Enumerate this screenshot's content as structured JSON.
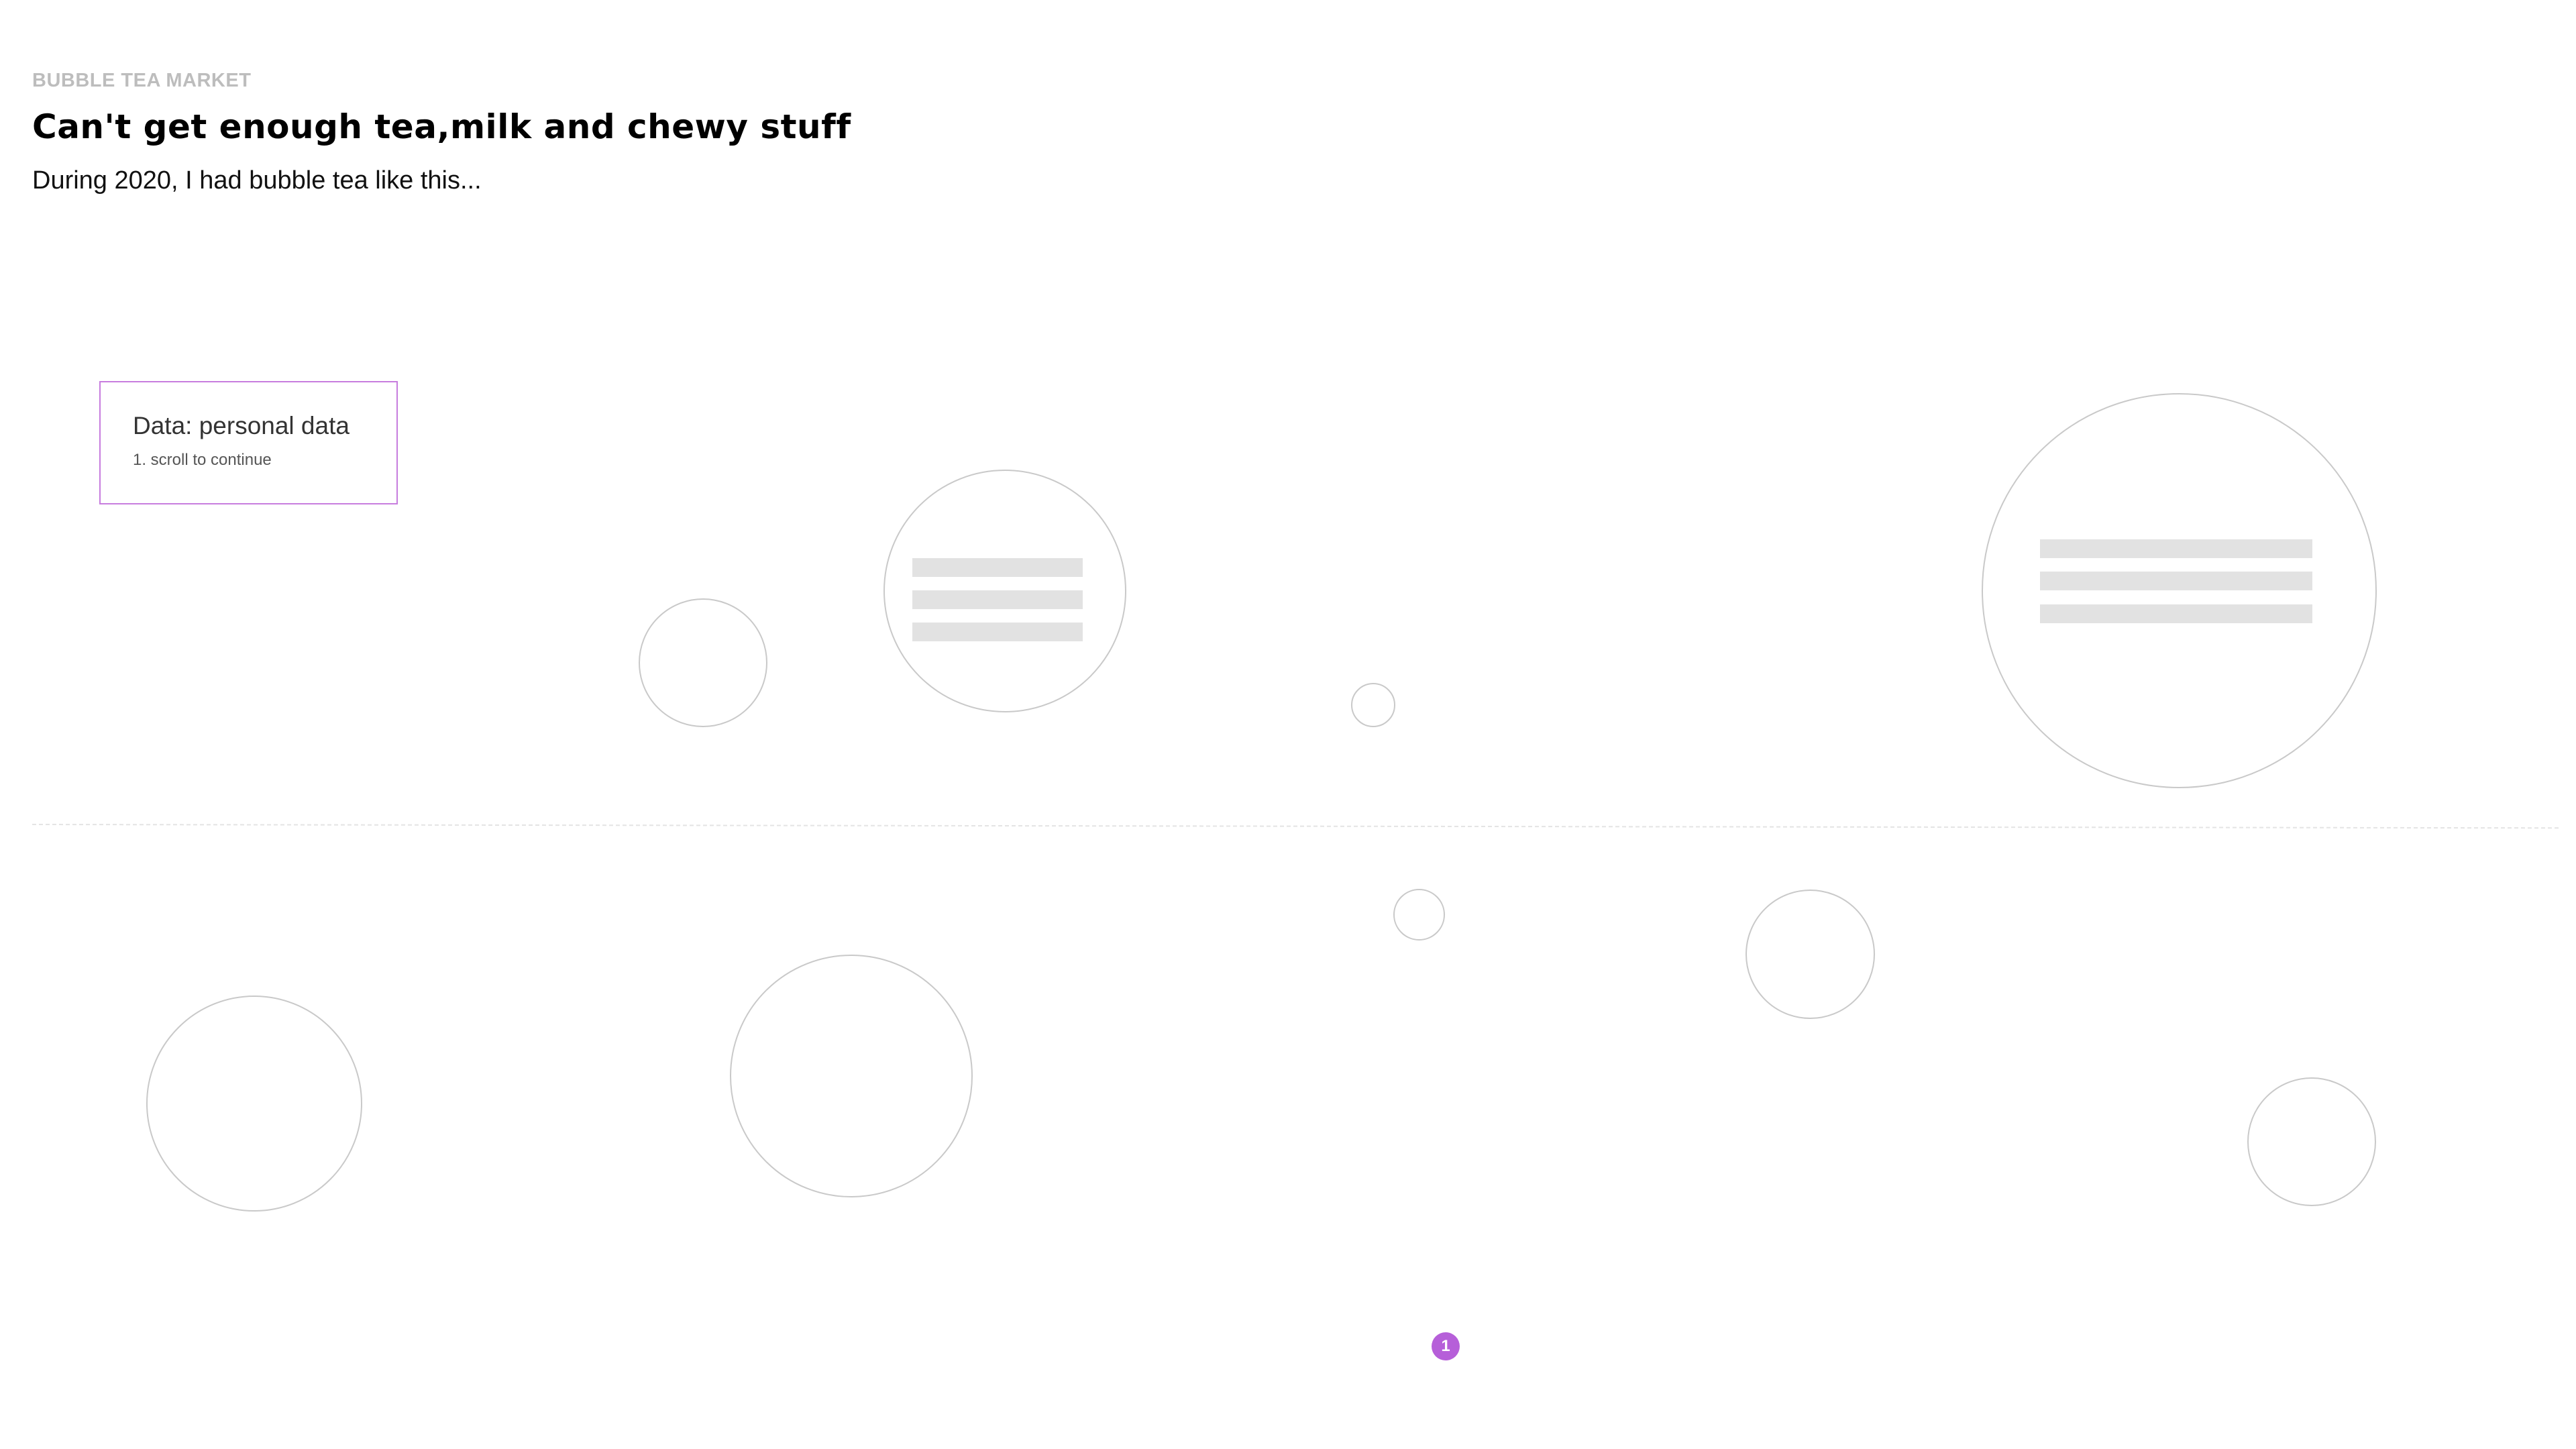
{
  "header": {
    "eyebrow": "BUBBLE TEA MARKET",
    "title": "Can't get enough tea,milk and chewy stuff",
    "subtitle": "During 2020, I had bubble tea like this..."
  },
  "info_box": {
    "title": "Data: personal data",
    "hint": "1. scroll to continue"
  },
  "stepper": {
    "current_step": "1"
  },
  "colors": {
    "accent": "#b65fd9",
    "box_border": "#c77dde",
    "bubble_stroke": "#c9c9c9",
    "skeleton": "#e2e2e2",
    "eyebrow": "#bdbdbd"
  }
}
